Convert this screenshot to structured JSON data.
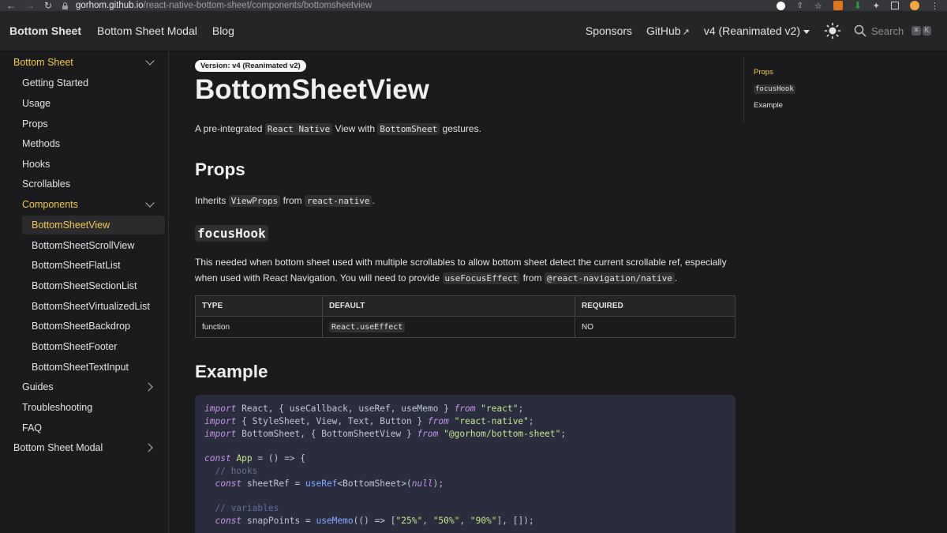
{
  "browser": {
    "url_host": "gorhom.github.io",
    "url_path": "/react-native-bottom-sheet/components/bottomsheetview"
  },
  "navbar": {
    "brand": "Bottom Sheet",
    "links": [
      "Bottom Sheet Modal",
      "Blog"
    ],
    "right_links": [
      "Sponsors",
      "GitHub"
    ],
    "version": "v4 (Reanimated v2)",
    "search_label": "Search",
    "search_keys": [
      "⌘",
      "K"
    ]
  },
  "sidebar": {
    "sections": [
      {
        "label": "Bottom Sheet",
        "active": true
      },
      {
        "label": "Getting Started"
      },
      {
        "label": "Usage"
      },
      {
        "label": "Props"
      },
      {
        "label": "Methods"
      },
      {
        "label": "Hooks"
      },
      {
        "label": "Scrollables"
      },
      {
        "label": "Components",
        "active": true
      },
      {
        "label": "BottomSheetView",
        "active": true
      },
      {
        "label": "BottomSheetScrollView"
      },
      {
        "label": "BottomSheetFlatList"
      },
      {
        "label": "BottomSheetSectionList"
      },
      {
        "label": "BottomSheetVirtualizedList"
      },
      {
        "label": "BottomSheetBackdrop"
      },
      {
        "label": "BottomSheetFooter"
      },
      {
        "label": "BottomSheetTextInput"
      },
      {
        "label": "Guides"
      },
      {
        "label": "Troubleshooting"
      },
      {
        "label": "FAQ"
      },
      {
        "label": "Bottom Sheet Modal"
      }
    ]
  },
  "main": {
    "badge": "Version: v4 (Reanimated v2)",
    "title": "BottomSheetView",
    "intro": {
      "pre": "A pre-integrated ",
      "code1": "React Native",
      "mid": " View with ",
      "code2": "BottomSheet",
      "post": " gestures."
    },
    "props_heading": "Props",
    "inherits": {
      "pre": "Inherits ",
      "code1": "ViewProps",
      "mid": " from ",
      "code2": "react-native",
      "post": "."
    },
    "focushook_heading": "focusHook",
    "focushook_desc": {
      "line1": "This needed when bottom sheet used with multiple scrollables to allow bottom sheet detect the current scrollable ref, especially",
      "line2_pre": "when used with React Navigation. You will need to provide ",
      "code1": "useFocusEffect",
      "mid": " from ",
      "code2": "@react-navigation/native",
      "post": "."
    },
    "table": {
      "headers": [
        "TYPE",
        "DEFAULT",
        "REQUIRED"
      ],
      "rows": [
        [
          "function",
          "React.useEffect",
          "NO"
        ]
      ]
    },
    "example_heading": "Example"
  },
  "toc": {
    "items": [
      "Props",
      "focusHook",
      "Example"
    ]
  },
  "colors": {
    "accent": "#f2c94c",
    "background": "#1b1b1d",
    "navbar": "#242526",
    "codeblock": "#292d3e"
  }
}
